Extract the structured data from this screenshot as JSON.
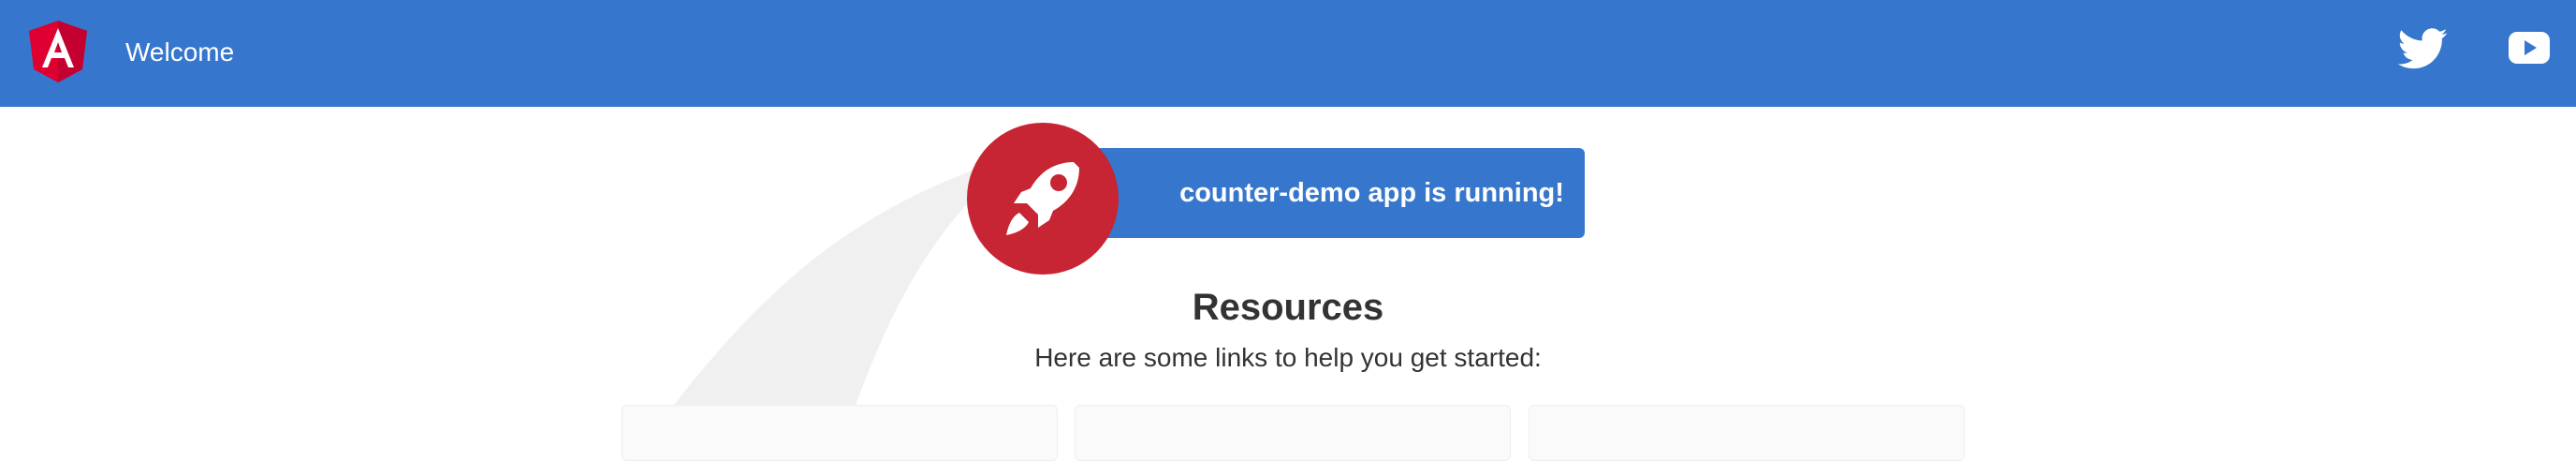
{
  "toolbar": {
    "title": "Welcome",
    "background_color": "#3677cd",
    "icons": [
      "angular-logo",
      "twitter-icon",
      "youtube-icon"
    ]
  },
  "banner": {
    "text": "counter-demo app is running!",
    "background_color": "#3677cd",
    "badge_color": "#c72434",
    "icon": "rocket-icon"
  },
  "resources": {
    "heading": "Resources",
    "subheading": "Here are some links to help you get started:"
  }
}
